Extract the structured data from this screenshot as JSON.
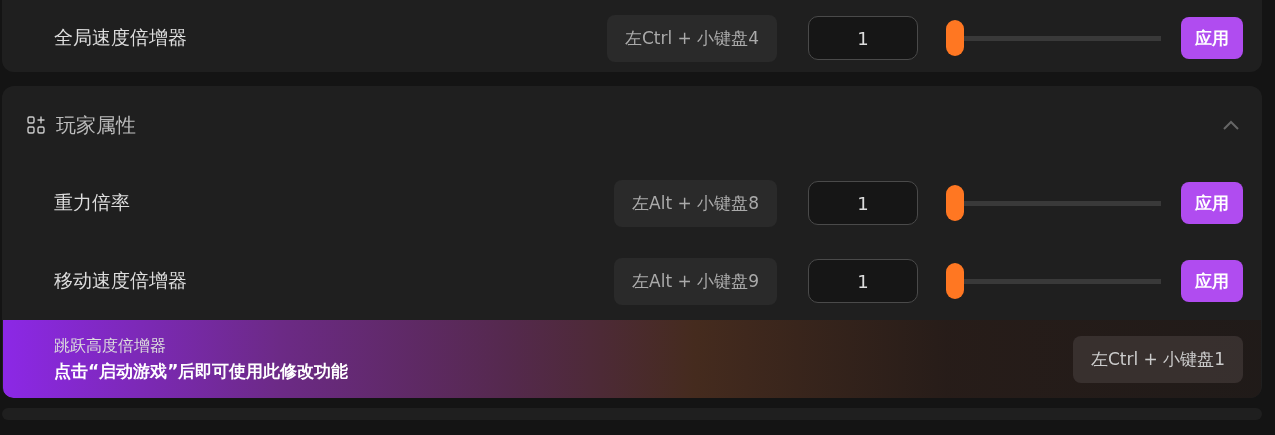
{
  "speed_card": {
    "rows": [
      {
        "label": "全局速度倍增器",
        "hotkey": "左Ctrl + 小键盘4",
        "value": "1",
        "level": 0,
        "apply": "应用"
      }
    ]
  },
  "player_section": {
    "title": "玩家属性",
    "expanded": true,
    "rows": [
      {
        "label": "重力倍率",
        "hotkey": "左Alt + 小键盘8",
        "value": "1",
        "level": 0,
        "apply": "应用"
      },
      {
        "label": "移动速度倍增器",
        "hotkey": "左Alt + 小键盘9",
        "value": "1",
        "level": 0,
        "apply": "应用"
      },
      {
        "toast": {
          "title": "跳跃高度倍增器",
          "message": "点击“启动游戏”后即可使用此修改功能",
          "hotkey": "左Ctrl + 小键盘1"
        }
      }
    ]
  }
}
